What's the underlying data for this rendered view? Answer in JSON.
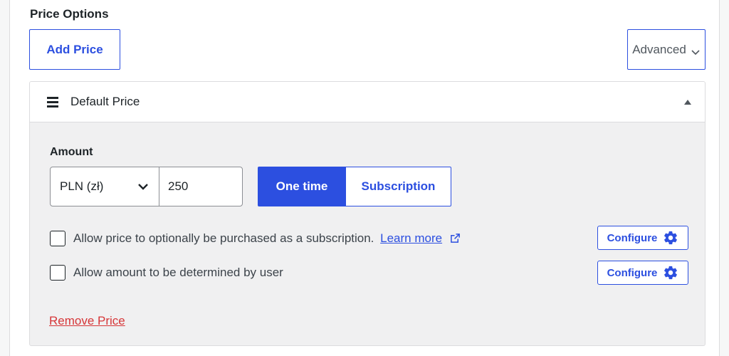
{
  "section": {
    "title": "Price Options"
  },
  "toolbar": {
    "add_price_label": "Add Price",
    "advanced_label": "Advanced"
  },
  "price": {
    "title": "Default Price",
    "amount_label": "Amount",
    "currency": "PLN (zł)",
    "amount_value": "250",
    "type_options": [
      "One time",
      "Subscription"
    ],
    "selected_type": "One time",
    "options": [
      {
        "text": "Allow price to optionally be purchased as a subscription.",
        "link": "Learn more",
        "checked": false,
        "configure_label": "Configure"
      },
      {
        "text": "Allow amount to be determined by user",
        "checked": false,
        "configure_label": "Configure"
      }
    ],
    "remove_label": "Remove Price"
  },
  "icons": {
    "menu": "hamburger-icon",
    "collapse": "triangle-up-icon",
    "select": "chevron-down-icon",
    "external": "external-link-icon",
    "settings": "gear-icon"
  },
  "colors": {
    "accent": "#2c4fe0",
    "danger": "#d63638",
    "panel_bg": "#f0f0f1"
  }
}
